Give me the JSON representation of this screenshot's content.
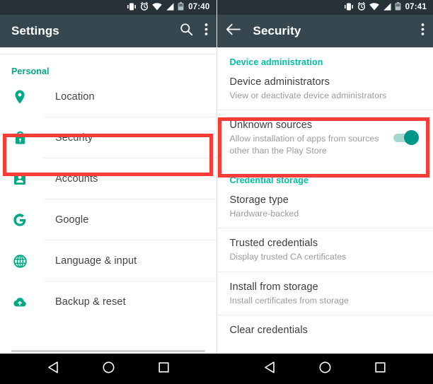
{
  "left_pane": {
    "status_bar": {
      "time": "07:40",
      "icons": [
        "vibrate-icon",
        "alarm-icon",
        "wifi-icon",
        "signal-icon",
        "battery-icon"
      ]
    },
    "app_bar": {
      "title": "Settings",
      "actions": [
        "search-icon",
        "overflow-menu-icon"
      ]
    },
    "section_header": "Personal",
    "items": [
      {
        "label": "Location",
        "icon": "location-pin-icon"
      },
      {
        "label": "Security",
        "icon": "lock-icon",
        "highlighted": true
      },
      {
        "label": "Accounts",
        "icon": "account-badge-icon"
      },
      {
        "label": "Google",
        "icon": "google-g-icon"
      },
      {
        "label": "Language & input",
        "icon": "globe-icon"
      },
      {
        "label": "Backup & reset",
        "icon": "cloud-upload-icon"
      }
    ]
  },
  "right_pane": {
    "status_bar": {
      "time": "07:41",
      "icons": [
        "vibrate-icon",
        "alarm-icon",
        "wifi-icon",
        "signal-icon",
        "battery-icon"
      ]
    },
    "app_bar": {
      "back": "back-arrow-icon",
      "title": "Security",
      "actions": [
        "overflow-menu-icon"
      ]
    },
    "sections": [
      {
        "header": "Device administration",
        "items": [
          {
            "title": "Device administrators",
            "subtitle": "View or deactivate device administrators"
          },
          {
            "title": "Unknown sources",
            "subtitle": "Allow installation of apps from sources other than the Play Store",
            "toggle": {
              "state": "on",
              "on_color": "#009688",
              "track_color": "#a5d9d0"
            },
            "highlighted": true
          }
        ]
      },
      {
        "header": "Credential storage",
        "items": [
          {
            "title": "Storage type",
            "subtitle": "Hardware-backed"
          },
          {
            "title": "Trusted credentials",
            "subtitle": "Display trusted CA certificates"
          },
          {
            "title": "Install from storage",
            "subtitle": "Install certificates from storage"
          },
          {
            "title": "Clear credentials",
            "subtitle": ""
          }
        ]
      }
    ]
  },
  "nav_bar": {
    "buttons": [
      "back-triangle-icon",
      "home-circle-icon",
      "recents-square-icon"
    ]
  },
  "colors": {
    "accent_teal": "#00a884",
    "app_bar": "#37474f",
    "status_bar": "#263238",
    "highlight_red": "#fa3c36"
  }
}
